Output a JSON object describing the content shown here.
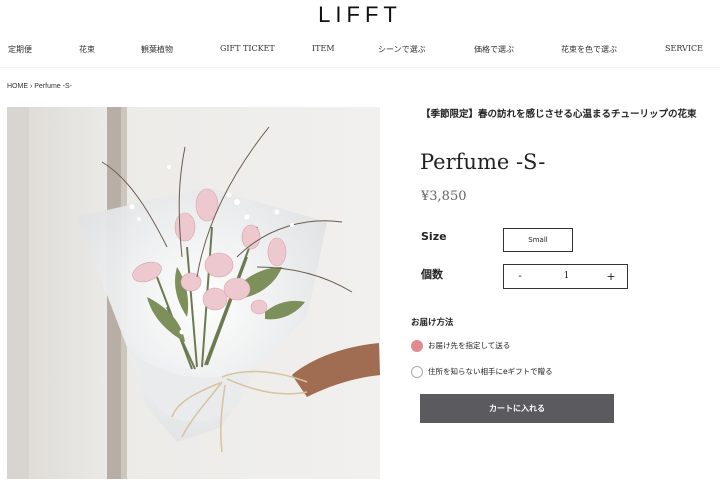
{
  "header": {
    "logo": "LIFFT",
    "nav": [
      {
        "label": "定期便"
      },
      {
        "label": "花束"
      },
      {
        "label": "観葉植物"
      },
      {
        "label": "GIFT TICKET"
      },
      {
        "label": "ITEM"
      },
      {
        "label": "シーンで選ぶ"
      },
      {
        "label": "価格で選ぶ"
      },
      {
        "label": "花束を色で選ぶ"
      },
      {
        "label": "SERVICE"
      }
    ]
  },
  "breadcrumb": {
    "home": "HOME",
    "separator": "›",
    "current": "Perfume -S-"
  },
  "product": {
    "image_alt": "Pink tulip bouquet wrapped in white paper",
    "subtitle": "【季節限定】春の訪れを感じさせる心温まるチューリップの花束",
    "title": "Perfume -S-",
    "price": "¥3,850",
    "size_label": "Size",
    "size_value": "Small",
    "quantity_label": "個数",
    "quantity_minus": "-",
    "quantity_value": "1",
    "quantity_plus": "+"
  },
  "delivery": {
    "heading": "お届け方法",
    "options": [
      {
        "label": "お届け先を指定して送る",
        "selected": true
      },
      {
        "label": "住所を知らない相手にeギフトで贈る",
        "selected": false
      }
    ]
  },
  "cart": {
    "button_label": "カートに入れる"
  },
  "colors": {
    "accent": "#e08a8f",
    "button": "#5a5a5f"
  }
}
